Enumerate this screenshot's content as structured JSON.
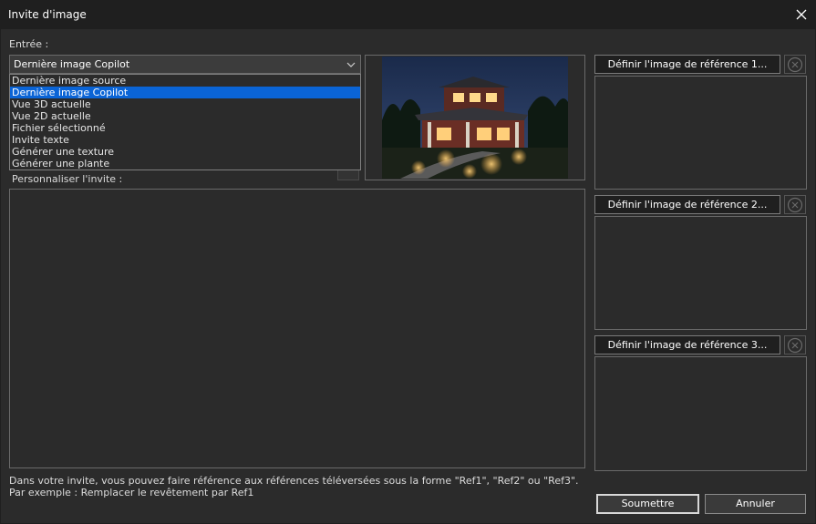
{
  "window": {
    "title": "Invite d'image"
  },
  "input": {
    "label": "Entrée :",
    "selected": "Dernière image Copilot",
    "options": [
      "Dernière image source",
      "Dernière image Copilot",
      "Vue 3D actuelle",
      "Vue 2D actuelle",
      "Fichier sélectionné",
      "Invite texte",
      "Générer une texture",
      "Générer une plante"
    ],
    "selected_index": 1
  },
  "prompt": {
    "label": "Personnaliser l'invite :",
    "value": ""
  },
  "references": [
    {
      "button_label": "Définir l'image de référence 1..."
    },
    {
      "button_label": "Définir l'image de référence 2..."
    },
    {
      "button_label": "Définir l'image de référence 3..."
    }
  ],
  "hints": {
    "line1": "Dans votre invite, vous pouvez faire référence aux références téléversées sous la forme \"Ref1\", \"Ref2\" ou \"Ref3\".",
    "line2": "Par exemple : Remplacer le revêtement par Ref1"
  },
  "actions": {
    "submit": "Soumettre",
    "cancel": "Annuler"
  },
  "colors": {
    "background": "#2b2b2b",
    "selection": "#0a64d6",
    "titlebar": "#1f1f1f"
  }
}
